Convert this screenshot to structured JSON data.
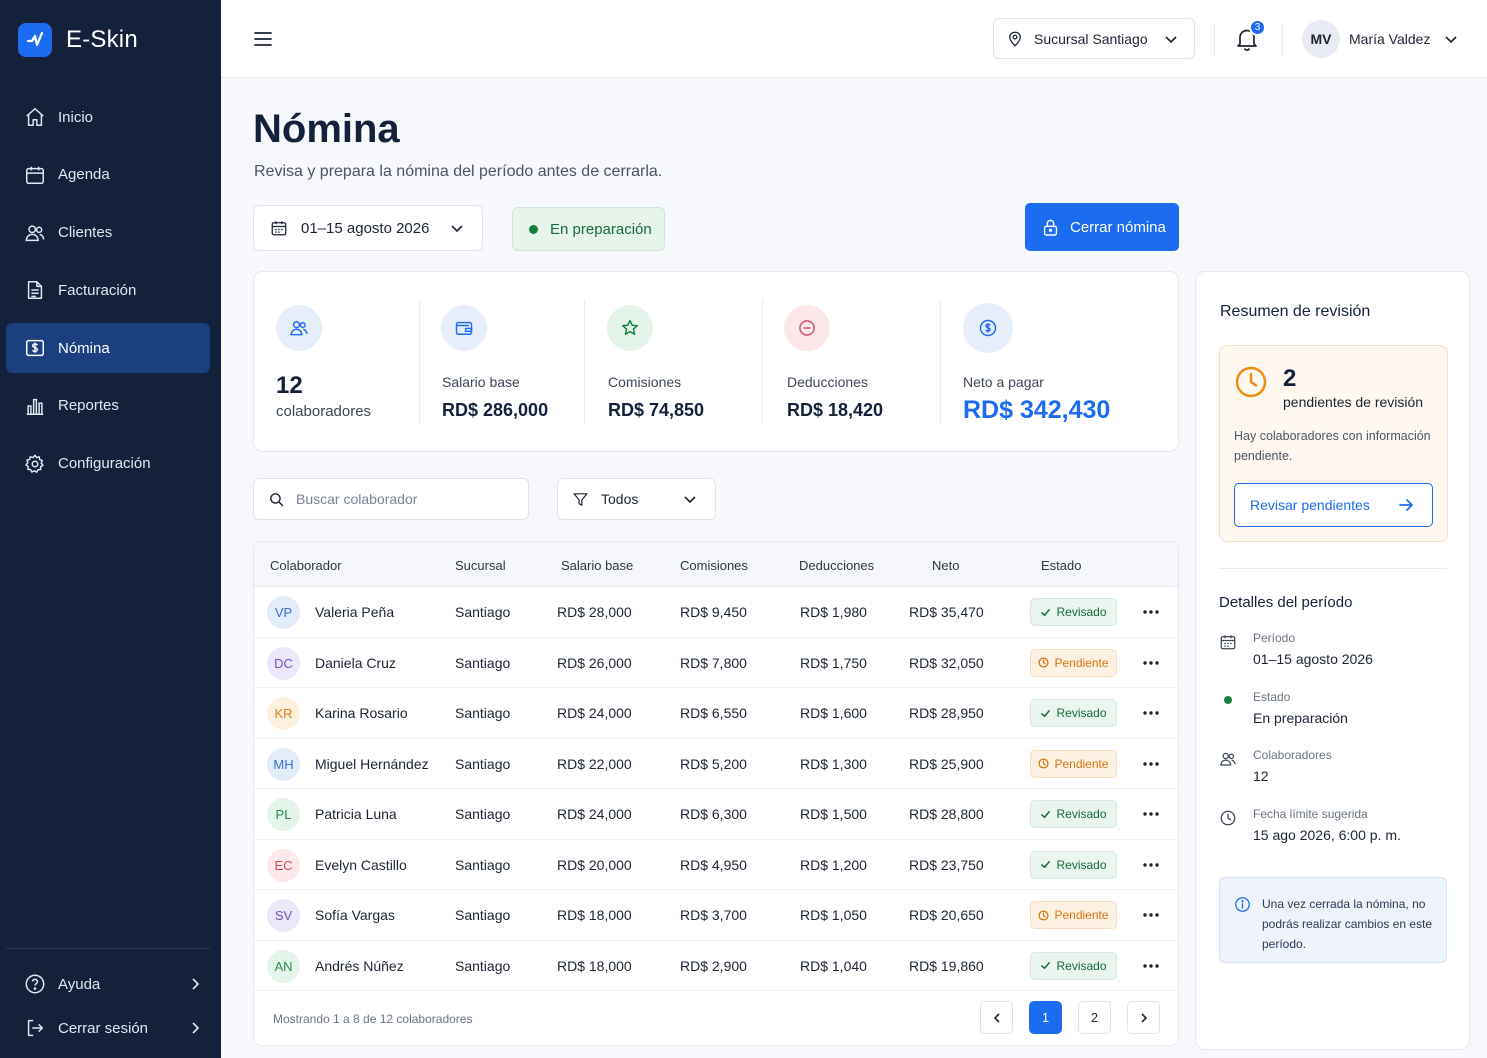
{
  "brand": {
    "name": "E-Skin"
  },
  "sidebar": {
    "items": [
      {
        "label": "Inicio",
        "icon": "home-icon"
      },
      {
        "label": "Agenda",
        "icon": "calendar-icon"
      },
      {
        "label": "Clientes",
        "icon": "users-icon"
      },
      {
        "label": "Facturación",
        "icon": "invoice-icon"
      },
      {
        "label": "Nómina",
        "icon": "payroll-icon",
        "active": true
      },
      {
        "label": "Reportes",
        "icon": "bar-chart-icon"
      },
      {
        "label": "Configuración",
        "icon": "gear-icon"
      }
    ],
    "bottom": [
      {
        "label": "Ayuda",
        "icon": "help-icon"
      },
      {
        "label": "Cerrar sesión",
        "icon": "logout-icon"
      }
    ]
  },
  "topbar": {
    "branch": "Sucursal Santiago",
    "notifications_count": "3",
    "user_initials": "MV",
    "user_name": "María Valdez"
  },
  "page": {
    "title": "Nómina",
    "subtitle": "Revisa y prepara la nómina del período antes de cerrarla.",
    "period": "01–15 agosto 2026",
    "status": "En preparación",
    "close_button": "Cerrar nómina"
  },
  "stats": {
    "collaborators_count": "12",
    "collaborators_label": "colaboradores",
    "base_salary_label": "Salario base",
    "base_salary_value": "RD$ 286,000",
    "commissions_label": "Comisiones",
    "commissions_value": "RD$ 74,850",
    "deductions_label": "Deducciones",
    "deductions_value": "RD$ 18,420",
    "net_label": "Neto a pagar",
    "net_value": "RD$ 342,430"
  },
  "filters": {
    "search_placeholder": "Buscar colaborador",
    "filter_value": "Todos"
  },
  "table": {
    "columns": [
      "Colaborador",
      "Sucursal",
      "Salario base",
      "Comisiones",
      "Deducciones",
      "Neto",
      "Estado"
    ],
    "rows": [
      {
        "initials": "VP",
        "name": "Valeria Peña",
        "branch": "Santiago",
        "base": "RD$ 28,000",
        "commission": "RD$ 9,450",
        "deduction": "RD$ 1,980",
        "net": "RD$ 35,470",
        "status": "Revisado"
      },
      {
        "initials": "DC",
        "name": "Daniela Cruz",
        "branch": "Santiago",
        "base": "RD$ 26,000",
        "commission": "RD$ 7,800",
        "deduction": "RD$ 1,750",
        "net": "RD$ 32,050",
        "status": "Pendiente"
      },
      {
        "initials": "KR",
        "name": "Karina Rosario",
        "branch": "Santiago",
        "base": "RD$ 24,000",
        "commission": "RD$ 6,550",
        "deduction": "RD$ 1,600",
        "net": "RD$ 28,950",
        "status": "Revisado"
      },
      {
        "initials": "MH",
        "name": "Miguel Hernández",
        "branch": "Santiago",
        "base": "RD$ 22,000",
        "commission": "RD$ 5,200",
        "deduction": "RD$ 1,300",
        "net": "RD$ 25,900",
        "status": "Pendiente"
      },
      {
        "initials": "PL",
        "name": "Patricia Luna",
        "branch": "Santiago",
        "base": "RD$ 24,000",
        "commission": "RD$ 6,300",
        "deduction": "RD$ 1,500",
        "net": "RD$ 28,800",
        "status": "Revisado"
      },
      {
        "initials": "EC",
        "name": "Evelyn Castillo",
        "branch": "Santiago",
        "base": "RD$ 20,000",
        "commission": "RD$ 4,950",
        "deduction": "RD$ 1,200",
        "net": "RD$ 23,750",
        "status": "Revisado"
      },
      {
        "initials": "SV",
        "name": "Sofía Vargas",
        "branch": "Santiago",
        "base": "RD$ 18,000",
        "commission": "RD$ 3,700",
        "deduction": "RD$ 1,050",
        "net": "RD$ 20,650",
        "status": "Pendiente"
      },
      {
        "initials": "AN",
        "name": "Andrés Núñez",
        "branch": "Santiago",
        "base": "RD$ 18,000",
        "commission": "RD$ 2,900",
        "deduction": "RD$ 1,040",
        "net": "RD$ 19,860",
        "status": "Revisado"
      }
    ],
    "showing": "Mostrando 1 a 8 de 12 colaboradores",
    "pages": [
      "1",
      "2"
    ],
    "current_page": "1"
  },
  "summary": {
    "title": "Resumen de revisión",
    "pending_count": "2",
    "pending_label": "pendientes de revisión",
    "pending_desc": "Hay colaboradores con información pendiente.",
    "review_button": "Revisar pendientes",
    "details_title": "Detalles del período",
    "details": [
      {
        "label": "Período",
        "value": "01–15 agosto 2026"
      },
      {
        "label": "Estado",
        "value": "En preparación"
      },
      {
        "label": "Colaboradores",
        "value": "12"
      },
      {
        "label": "Fecha límite sugerida",
        "value": "15 ago 2026, 6:00 p. m."
      }
    ],
    "info": "Una vez cerrada la nómina, no podrás realizar cambios en este período."
  },
  "colors": {
    "sidebar_bg": "#14213a",
    "accent": "#1c6cf2",
    "success": "#15803d",
    "warning": "#d9730d",
    "net_value": "#1c6cf2"
  },
  "avatar_colors": {
    "VP": [
      "#e3ecfb",
      "#3b6fd1"
    ],
    "DC": [
      "#ece7fa",
      "#7252c8"
    ],
    "KR": [
      "#fdf0df",
      "#d98318"
    ],
    "MH": [
      "#e3ecfb",
      "#3b6fd1"
    ],
    "PL": [
      "#e5f4ea",
      "#2d8a4e"
    ],
    "EC": [
      "#fce8ea",
      "#d64b5c"
    ],
    "SV": [
      "#ece7fa",
      "#7252c8"
    ],
    "AN": [
      "#e5f4ea",
      "#2d8a4e"
    ]
  }
}
